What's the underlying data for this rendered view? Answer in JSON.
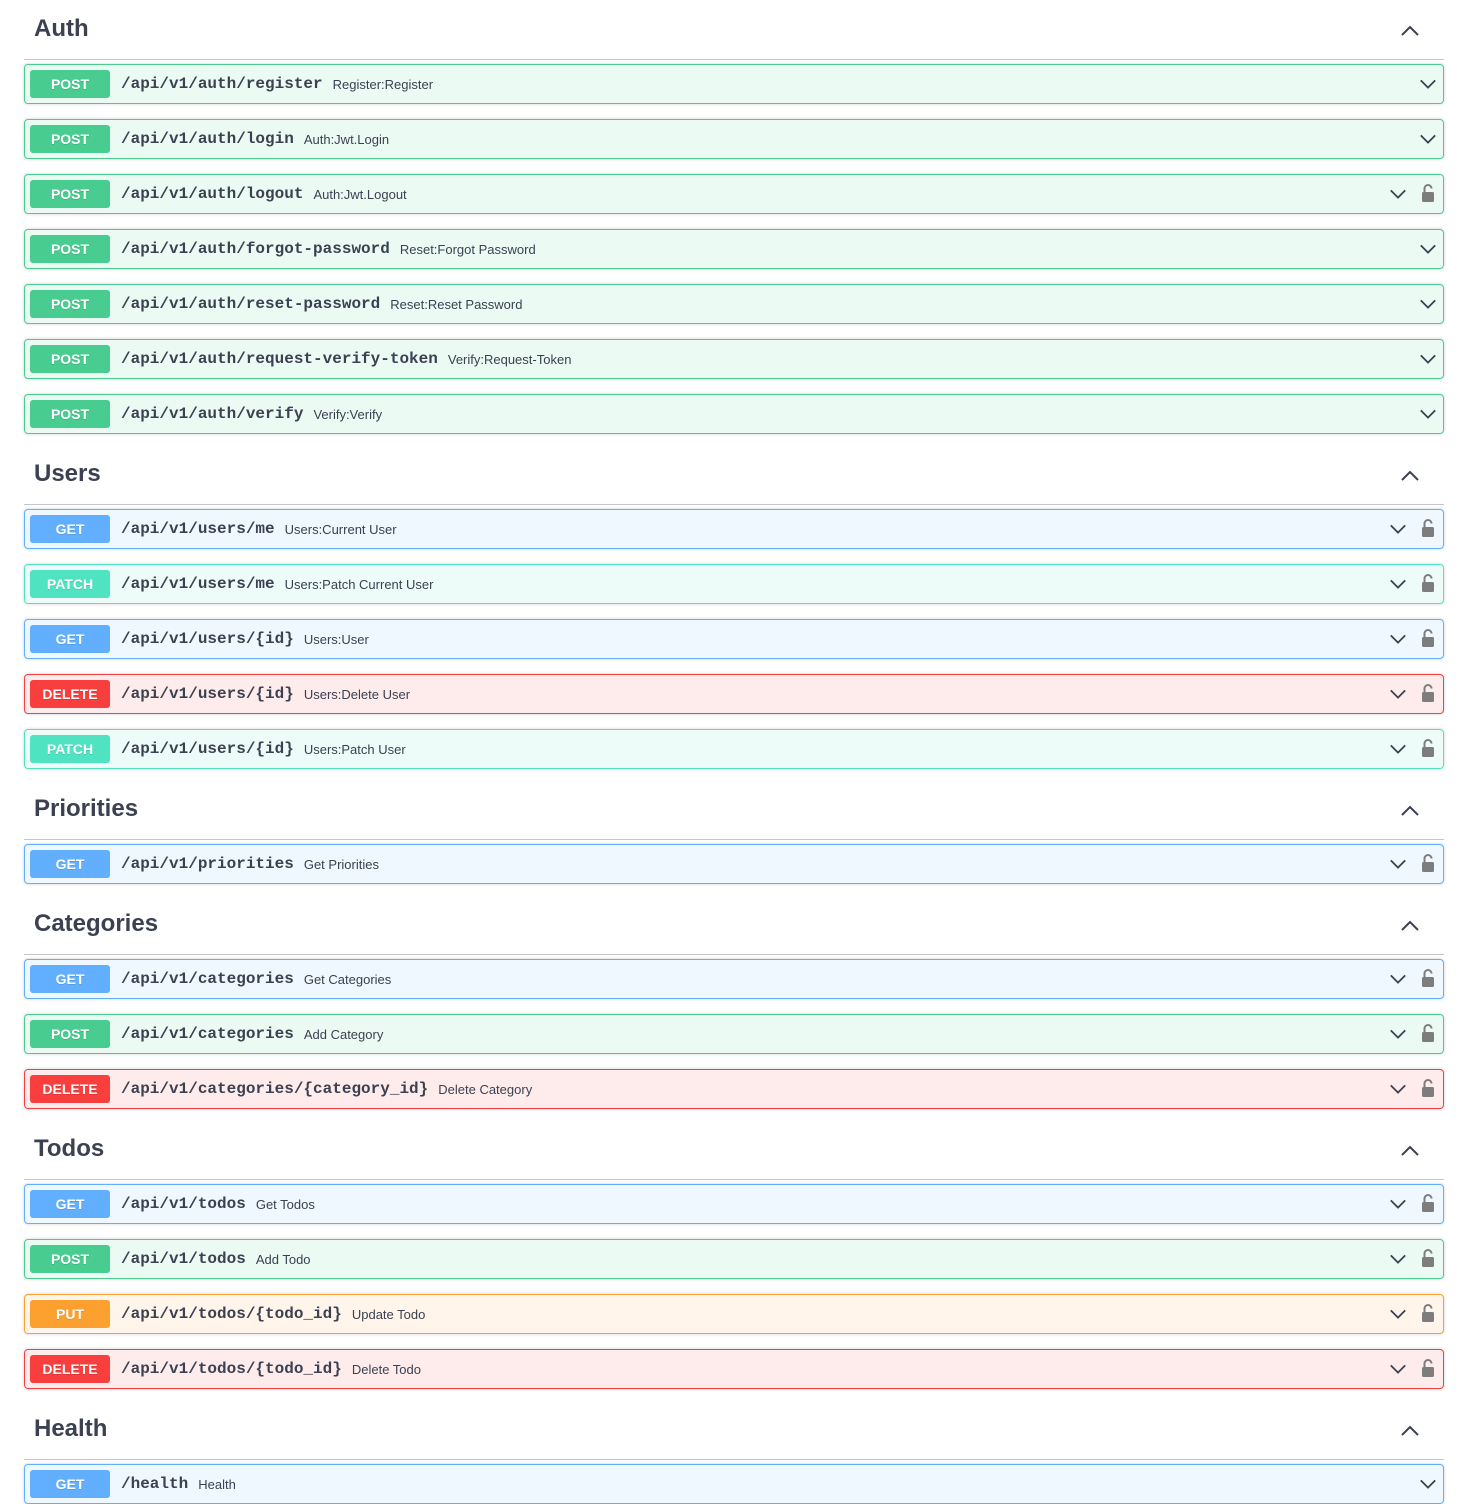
{
  "sections": [
    {
      "name": "Auth",
      "ops": [
        {
          "method": "POST",
          "path": "/api/v1/auth/register",
          "summary": "Register:Register",
          "locked": false
        },
        {
          "method": "POST",
          "path": "/api/v1/auth/login",
          "summary": "Auth:Jwt.Login",
          "locked": false
        },
        {
          "method": "POST",
          "path": "/api/v1/auth/logout",
          "summary": "Auth:Jwt.Logout",
          "locked": true
        },
        {
          "method": "POST",
          "path": "/api/v1/auth/forgot-password",
          "summary": "Reset:Forgot Password",
          "locked": false
        },
        {
          "method": "POST",
          "path": "/api/v1/auth/reset-password",
          "summary": "Reset:Reset Password",
          "locked": false
        },
        {
          "method": "POST",
          "path": "/api/v1/auth/request-verify-token",
          "summary": "Verify:Request-Token",
          "locked": false
        },
        {
          "method": "POST",
          "path": "/api/v1/auth/verify",
          "summary": "Verify:Verify",
          "locked": false
        }
      ]
    },
    {
      "name": "Users",
      "ops": [
        {
          "method": "GET",
          "path": "/api/v1/users/me",
          "summary": "Users:Current User",
          "locked": true
        },
        {
          "method": "PATCH",
          "path": "/api/v1/users/me",
          "summary": "Users:Patch Current User",
          "locked": true
        },
        {
          "method": "GET",
          "path": "/api/v1/users/{id}",
          "summary": "Users:User",
          "locked": true
        },
        {
          "method": "DELETE",
          "path": "/api/v1/users/{id}",
          "summary": "Users:Delete User",
          "locked": true
        },
        {
          "method": "PATCH",
          "path": "/api/v1/users/{id}",
          "summary": "Users:Patch User",
          "locked": true
        }
      ]
    },
    {
      "name": "Priorities",
      "ops": [
        {
          "method": "GET",
          "path": "/api/v1/priorities",
          "summary": "Get Priorities",
          "locked": true
        }
      ]
    },
    {
      "name": "Categories",
      "ops": [
        {
          "method": "GET",
          "path": "/api/v1/categories",
          "summary": "Get Categories",
          "locked": true
        },
        {
          "method": "POST",
          "path": "/api/v1/categories",
          "summary": "Add Category",
          "locked": true
        },
        {
          "method": "DELETE",
          "path": "/api/v1/categories/{category_id}",
          "summary": "Delete Category",
          "locked": true
        }
      ]
    },
    {
      "name": "Todos",
      "ops": [
        {
          "method": "GET",
          "path": "/api/v1/todos",
          "summary": "Get Todos",
          "locked": true
        },
        {
          "method": "POST",
          "path": "/api/v1/todos",
          "summary": "Add Todo",
          "locked": true
        },
        {
          "method": "PUT",
          "path": "/api/v1/todos/{todo_id}",
          "summary": "Update Todo",
          "locked": true
        },
        {
          "method": "DELETE",
          "path": "/api/v1/todos/{todo_id}",
          "summary": "Delete Todo",
          "locked": true
        }
      ]
    },
    {
      "name": "Health",
      "ops": [
        {
          "method": "GET",
          "path": "/health",
          "summary": "Health",
          "locked": false
        }
      ]
    }
  ],
  "colors": {
    "post": "#49cc90",
    "get": "#61affe",
    "patch": "#50e3c2",
    "delete": "#f93e3e",
    "put": "#fca130",
    "text": "#3b4151"
  },
  "icons": {
    "section_toggle": "chevron-up-icon",
    "op_toggle": "chevron-down-icon",
    "auth": "lock-icon"
  }
}
